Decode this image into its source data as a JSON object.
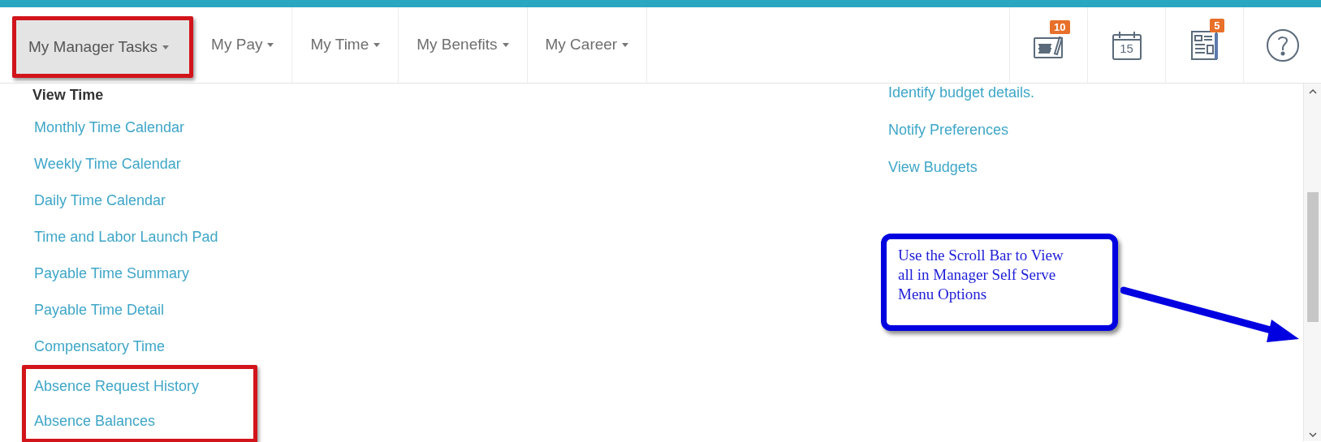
{
  "nav": {
    "tabs": [
      {
        "label": "My Manager Tasks",
        "selected": true,
        "highlighted": true
      },
      {
        "label": "My Pay",
        "selected": false,
        "highlighted": false
      },
      {
        "label": "My Time",
        "selected": false,
        "highlighted": false
      },
      {
        "label": "My Benefits",
        "selected": false,
        "highlighted": false
      },
      {
        "label": "My Career",
        "selected": false,
        "highlighted": false
      }
    ],
    "tools": [
      {
        "kind": "notes",
        "badge": "10"
      },
      {
        "kind": "calendar",
        "day": "15"
      },
      {
        "kind": "news",
        "badge": "5"
      },
      {
        "kind": "help"
      }
    ]
  },
  "dropdown": {
    "left": {
      "heading": "View Time",
      "items": [
        {
          "label": "Monthly Time Calendar",
          "highlighted": false
        },
        {
          "label": "Weekly Time Calendar",
          "highlighted": false
        },
        {
          "label": "Daily Time Calendar",
          "highlighted": false
        },
        {
          "label": "Time and Labor Launch Pad",
          "highlighted": false
        },
        {
          "label": "Payable Time Summary",
          "highlighted": false
        },
        {
          "label": "Payable Time Detail",
          "highlighted": false
        },
        {
          "label": "Compensatory Time",
          "highlighted": false
        },
        {
          "label": "Absence Request History",
          "highlighted": true
        },
        {
          "label": "Absence Balances",
          "highlighted": true
        }
      ]
    },
    "right": {
      "items": [
        {
          "label": "Identify budget details."
        },
        {
          "label": "Notify Preferences"
        },
        {
          "label": "View Budgets"
        }
      ]
    }
  },
  "callout": {
    "text": "Use the Scroll Bar to View all in Manager Self Serve Menu Options"
  }
}
